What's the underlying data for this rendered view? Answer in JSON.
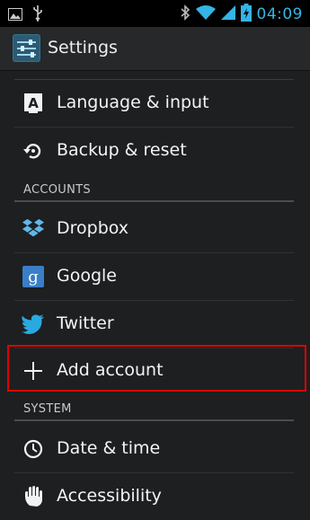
{
  "status_bar": {
    "time": "04:09",
    "icons": [
      "picture-icon",
      "usb-icon",
      "bluetooth-icon",
      "wifi-icon",
      "signal-icon",
      "battery-icon"
    ]
  },
  "action_bar": {
    "title": "Settings",
    "app_icon": "settings-app-icon"
  },
  "sections": [
    {
      "items": [
        {
          "label": "Language & input",
          "icon": "keyboard-a-icon"
        },
        {
          "label": "Backup & reset",
          "icon": "backup-reset-icon"
        }
      ]
    },
    {
      "header": "ACCOUNTS",
      "items": [
        {
          "label": "Dropbox",
          "icon": "dropbox-icon"
        },
        {
          "label": "Google",
          "icon": "google-g-icon"
        },
        {
          "label": "Twitter",
          "icon": "twitter-bird-icon"
        },
        {
          "label": "Add account",
          "icon": "plus-icon"
        }
      ]
    },
    {
      "header": "SYSTEM",
      "items": [
        {
          "label": "Date & time",
          "icon": "clock-icon"
        },
        {
          "label": "Accessibility",
          "icon": "hand-icon"
        }
      ]
    }
  ],
  "colors": {
    "accent": "#33b5e5",
    "highlight": "#e00000",
    "background": "#1d1f20"
  }
}
